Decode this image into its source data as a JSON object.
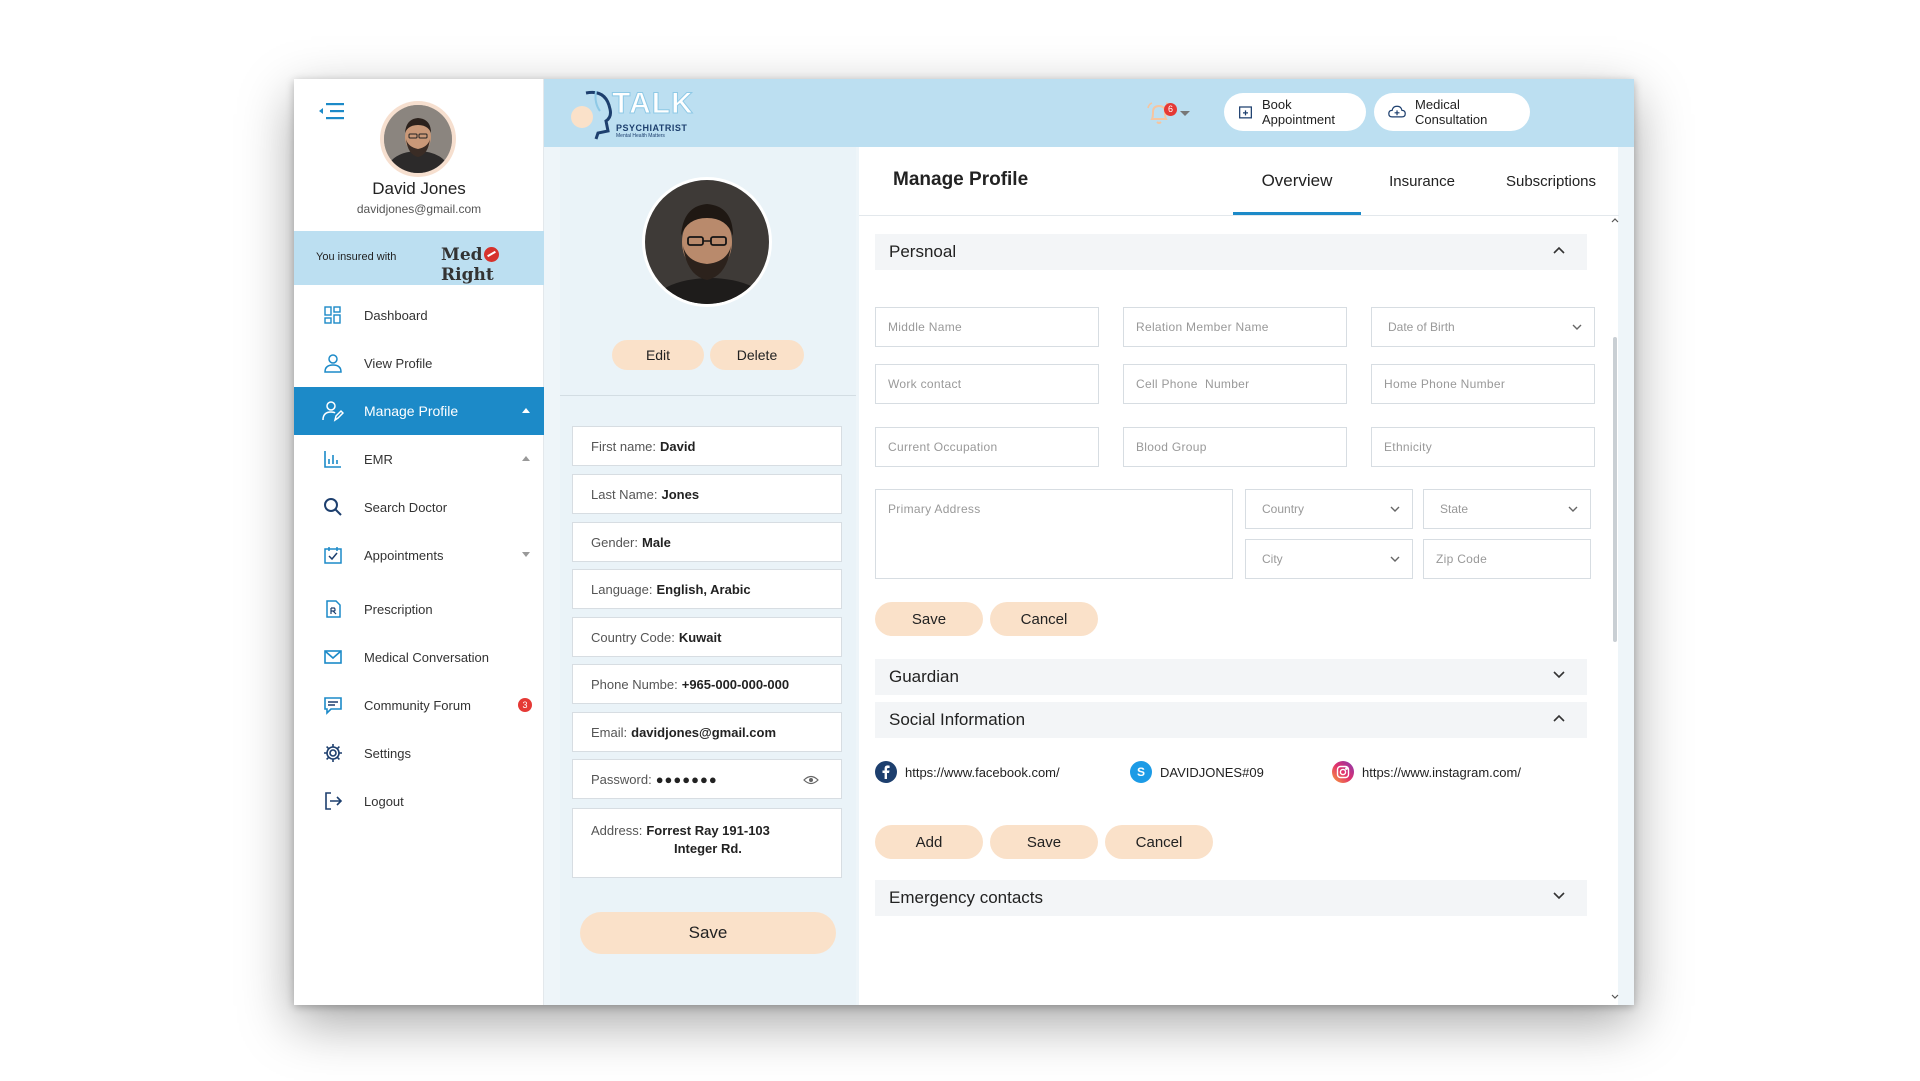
{
  "user": {
    "name": "David Jones",
    "email": "davidjones@gmail.com"
  },
  "insurance": {
    "label": "You insured with",
    "provider": "MedRight"
  },
  "nav": {
    "items": [
      {
        "label": "Dashboard",
        "icon": "dashboard-icon"
      },
      {
        "label": "View Profile",
        "icon": "user-icon"
      },
      {
        "label": "Manage Profile",
        "icon": "user-edit-icon",
        "active": true
      },
      {
        "label": "EMR",
        "icon": "bar-chart-icon"
      },
      {
        "label": "Search Doctor",
        "icon": "search-icon"
      },
      {
        "label": "Appointments",
        "icon": "calendar-check-icon"
      },
      {
        "label": "Prescription",
        "icon": "prescription-icon"
      },
      {
        "label": "Medical Conversation",
        "icon": "mail-icon"
      },
      {
        "label": "Community Forum",
        "icon": "chat-icon",
        "badge": "3"
      },
      {
        "label": "Settings",
        "icon": "gear-icon"
      },
      {
        "label": "Logout",
        "icon": "logout-icon"
      }
    ]
  },
  "header": {
    "logo_main": "TALK",
    "logo_sub": "PSYCHIATRIST",
    "logo_tagline": "Mental Health Matters",
    "notification_count": "6",
    "book_appointment": "Book Appointment",
    "medical_consultation": "Medical Consultation"
  },
  "profile_card": {
    "edit": "Edit",
    "delete": "Delete",
    "fields": {
      "first_name_label": "First name:",
      "first_name": "David",
      "last_name_label": "Last Name:",
      "last_name": "Jones",
      "gender_label": "Gender:",
      "gender": "Male",
      "language_label": "Language:",
      "language": "English, Arabic",
      "country_code_label": "Country Code:",
      "country_code": "Kuwait",
      "phone_label": "Phone Numbe:",
      "phone": "+965-000-000-000",
      "email_label": "Email:",
      "email": "davidjones@gmail.com",
      "password_label": "Password:",
      "password": "●●●●●●●",
      "address_label": "Address:",
      "address_line1": "Forrest Ray 191-103",
      "address_line2": "Integer Rd."
    },
    "save": "Save"
  },
  "manage": {
    "title": "Manage Profile",
    "tabs": [
      "Overview",
      "Insurance",
      "Subscriptions"
    ],
    "personal": {
      "title": "Persnoal",
      "placeholders": {
        "middle_name": "Middle Name",
        "relation_member_name": "Relation Member Name",
        "date_of_birth": "Date of Birth",
        "work_contact": "Work contact",
        "cell_phone": "Cell Phone  Number",
        "home_phone": "Home Phone Number",
        "current_occupation": "Current Occupation",
        "blood_group": "Blood Group",
        "ethnicity": "Ethnicity",
        "primary_address": "Primary Address",
        "country": "Country",
        "state": "State",
        "city": "City",
        "zip_code": "Zip Code"
      },
      "save": "Save",
      "cancel": "Cancel"
    },
    "guardian": {
      "title": "Guardian"
    },
    "social": {
      "title": "Social Information",
      "facebook": "https://www.facebook.com/",
      "skype": "DAVIDJONES#09",
      "instagram": "https://www.instagram.com/",
      "add": "Add",
      "save": "Save",
      "cancel": "Cancel"
    },
    "emergency": {
      "title": "Emergency contacts"
    }
  },
  "colors": {
    "primary": "#1c8ac8",
    "header_bg": "#bcdff1",
    "button_bg": "#fae1c9",
    "badge": "#e53935"
  }
}
